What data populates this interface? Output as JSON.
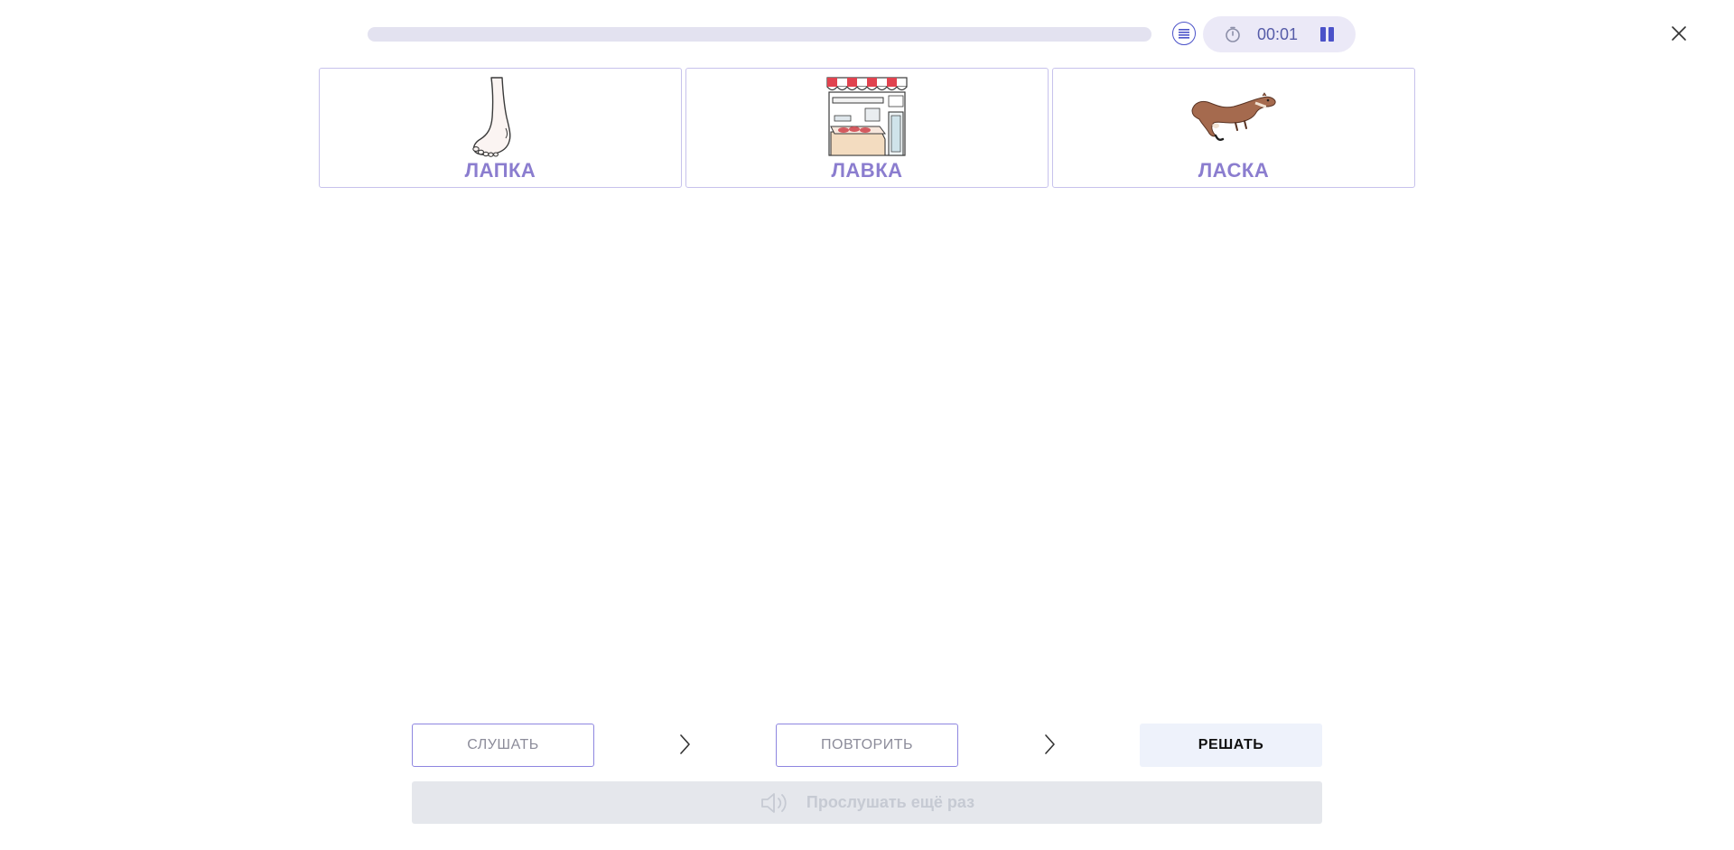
{
  "top_bar": {
    "progress": 0.0,
    "list_icon": "list-icon",
    "timer_icon": "stopwatch-icon",
    "timer": "00:01",
    "pause_icon": "pause-icon",
    "close_icon": "close-icon"
  },
  "cards": [
    {
      "label": "ЛАПКА",
      "picture": "foot-picture"
    },
    {
      "label": "ЛАВКА",
      "picture": "shop-stall-picture"
    },
    {
      "label": "ЛАСКА",
      "picture": "weasel-picture"
    }
  ],
  "steps": {
    "listen_label": "СЛУШАТЬ",
    "repeat_label": "ПОВТОРИТЬ",
    "solve_label": "РЕШАТЬ"
  },
  "replay": {
    "icon": "speaker-icon",
    "label": "Прослушать ещё раз",
    "enabled": false
  },
  "colors": {
    "accent": "#4b52c9",
    "card_label": "#8b7dcf",
    "card_border": "#c7c2ec",
    "timer_pill": "#ebe9f7",
    "solve_bg": "#eef2fb",
    "replay_bg": "#e5e7ec"
  }
}
